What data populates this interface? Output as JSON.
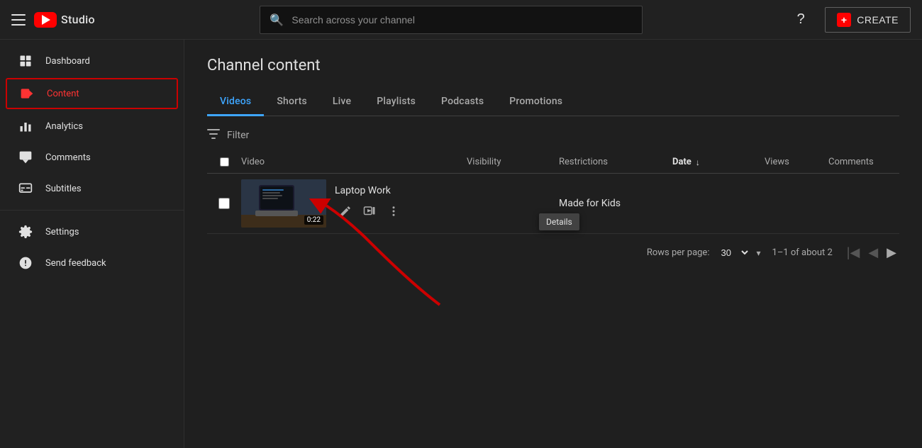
{
  "header": {
    "menu_icon_label": "menu",
    "logo_alt": "YouTube Studio",
    "studio_label": "Studio",
    "search_placeholder": "Search across your channel",
    "help_label": "Help",
    "create_label": "CREATE"
  },
  "sidebar": {
    "items": [
      {
        "id": "dashboard",
        "label": "Dashboard",
        "icon": "grid"
      },
      {
        "id": "content",
        "label": "Content",
        "icon": "play",
        "active": true
      },
      {
        "id": "analytics",
        "label": "Analytics",
        "icon": "bar-chart"
      },
      {
        "id": "comments",
        "label": "Comments",
        "icon": "comment"
      },
      {
        "id": "subtitles",
        "label": "Subtitles",
        "icon": "subtitles"
      },
      {
        "id": "settings",
        "label": "Settings",
        "icon": "gear"
      },
      {
        "id": "feedback",
        "label": "Send feedback",
        "icon": "feedback"
      }
    ]
  },
  "content": {
    "page_title": "Channel content",
    "tabs": [
      {
        "id": "videos",
        "label": "Videos",
        "active": true
      },
      {
        "id": "shorts",
        "label": "Shorts"
      },
      {
        "id": "live",
        "label": "Live"
      },
      {
        "id": "playlists",
        "label": "Playlists"
      },
      {
        "id": "podcasts",
        "label": "Podcasts"
      },
      {
        "id": "promotions",
        "label": "Promotions"
      }
    ],
    "filter_label": "Filter",
    "table": {
      "columns": [
        {
          "id": "video",
          "label": "Video"
        },
        {
          "id": "visibility",
          "label": "Visibility"
        },
        {
          "id": "restrictions",
          "label": "Restrictions"
        },
        {
          "id": "date",
          "label": "Date",
          "sorted": true
        },
        {
          "id": "views",
          "label": "Views"
        },
        {
          "id": "comments",
          "label": "Comments"
        }
      ],
      "rows": [
        {
          "id": "row1",
          "title": "Laptop Work",
          "duration": "0:22",
          "visibility": "",
          "restrictions": "Made for Kids",
          "date": "",
          "views": "",
          "comments": ""
        }
      ]
    },
    "pagination": {
      "rows_per_page_label": "Rows per page:",
      "rows_per_page_value": "30",
      "page_info": "1–1 of about 2"
    },
    "tooltip": "Details",
    "action_edit_label": "Edit",
    "action_watch_label": "Watch",
    "action_more_label": "More options"
  }
}
